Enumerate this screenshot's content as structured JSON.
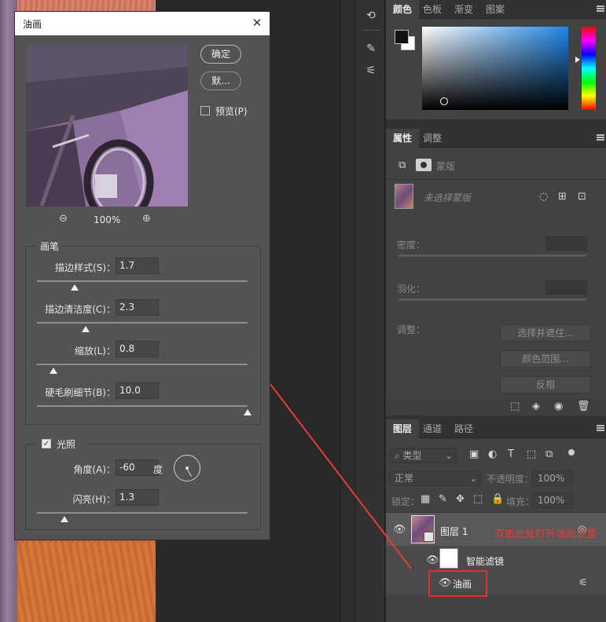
{
  "dialog": {
    "title": "油画",
    "close_glyph": "✕",
    "ok_label": "确定",
    "default_label": "默...",
    "preview_label": "预览(P)",
    "zoom_level": "100%",
    "brush_group_title": "画笔",
    "params": [
      {
        "label": "描边样式(S)：",
        "value": "1.7",
        "level": 0.18
      },
      {
        "label": "描边清洁度(C)：",
        "value": "2.3",
        "level": 0.23
      },
      {
        "label": "缩放(L)：",
        "value": "0.8",
        "level": 0.08
      },
      {
        "label": "硬毛刷细节(B)：",
        "value": "10.0",
        "level": 1.0
      }
    ],
    "lighting_group_title": "光照",
    "angle_label": "角度(A)：",
    "angle_value": "-60",
    "angle_unit": "度",
    "shine_label": "闪亮(H)：",
    "shine_value": "1.3",
    "shine_level": 0.13
  },
  "color_panel": {
    "tabs": [
      "颜色",
      "色板",
      "渐变",
      "图案"
    ],
    "accent": "#1f86e6"
  },
  "properties_panel": {
    "tabs": [
      "属性",
      "调整"
    ],
    "mask_label": "蒙版",
    "no_mask_text": "未选择蒙版",
    "density_label": "密度：",
    "feather_label": "羽化：",
    "adjust_label": "调整：",
    "select_mask_button": "选择并遮住...",
    "color_range_button": "颜色范围...",
    "invert_button": "反相"
  },
  "layers_panel": {
    "tabs": [
      "图层",
      "通道",
      "路径"
    ],
    "filter_kind": "类型",
    "blend_mode": "正常",
    "opacity_label": "不透明度：",
    "opacity_value": "100%",
    "lock_label": "锁定：",
    "fill_label": "填充：",
    "fill_value": "100%",
    "layer_name": "图层 1",
    "smart_filter_label": "智能滤镜",
    "filter_name": "油画"
  },
  "annotation": {
    "text": "双击此处打开油画设置",
    "color": "#e53b3b"
  }
}
